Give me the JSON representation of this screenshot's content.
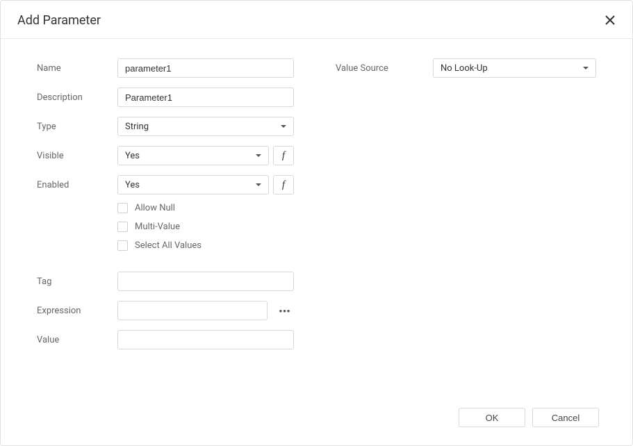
{
  "dialog": {
    "title": "Add Parameter"
  },
  "left": {
    "name_label": "Name",
    "name_value": "parameter1",
    "description_label": "Description",
    "description_value": "Parameter1",
    "type_label": "Type",
    "type_value": "String",
    "visible_label": "Visible",
    "visible_value": "Yes",
    "enabled_label": "Enabled",
    "enabled_value": "Yes",
    "allow_null_label": "Allow Null",
    "multi_value_label": "Multi-Value",
    "select_all_label": "Select All Values",
    "tag_label": "Tag",
    "tag_value": "",
    "expression_label": "Expression",
    "expression_value": "",
    "value_label": "Value",
    "value_value": ""
  },
  "right": {
    "value_source_label": "Value Source",
    "value_source_value": "No Look-Up"
  },
  "footer": {
    "ok_label": "OK",
    "cancel_label": "Cancel"
  }
}
